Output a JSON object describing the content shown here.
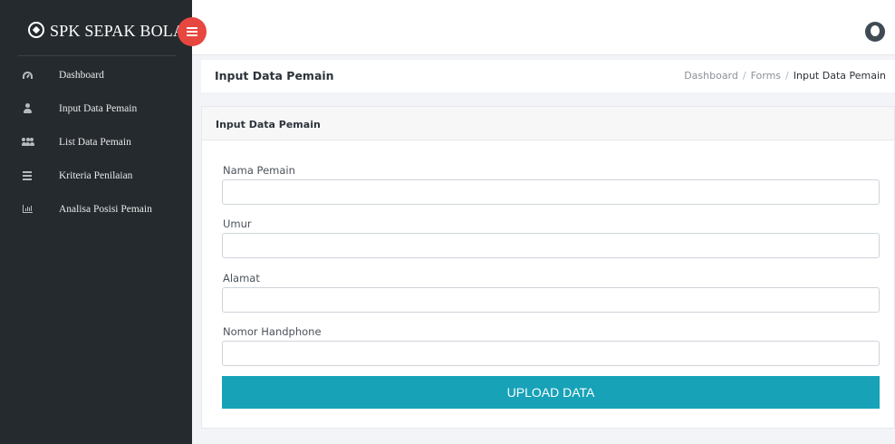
{
  "brand": {
    "title": "SPK SEPAK BOLA",
    "logo_icon": "soccer-ball-icon",
    "toggle_icon": "menu-icon",
    "toggle_color": "#e7473f"
  },
  "sidebar": {
    "background": "#252a2e",
    "items": [
      {
        "label": "Dashboard",
        "icon": "dashboard-icon"
      },
      {
        "label": "Input Data Pemain",
        "icon": "user-icon"
      },
      {
        "label": "List Data Pemain",
        "icon": "users-icon"
      },
      {
        "label": "Kriteria Penilaian",
        "icon": "list-icon"
      },
      {
        "label": "Analisa Posisi Pemain",
        "icon": "bar-chart-icon"
      }
    ]
  },
  "topbar": {
    "avatar_icon": "user-avatar-icon"
  },
  "page": {
    "title": "Input Data Pemain",
    "breadcrumb": [
      "Dashboard",
      "Forms",
      "Input Data Pemain"
    ]
  },
  "card": {
    "title": "Input Data Pemain"
  },
  "form": {
    "fields": [
      {
        "label": "Nama Pemain",
        "value": "",
        "placeholder": ""
      },
      {
        "label": "Umur",
        "value": "",
        "placeholder": ""
      },
      {
        "label": "Alamat",
        "value": "",
        "placeholder": ""
      },
      {
        "label": "Nomor Handphone",
        "value": "",
        "placeholder": ""
      }
    ],
    "submit_label": "UPLOAD DATA",
    "submit_color": "#17a2b8"
  }
}
